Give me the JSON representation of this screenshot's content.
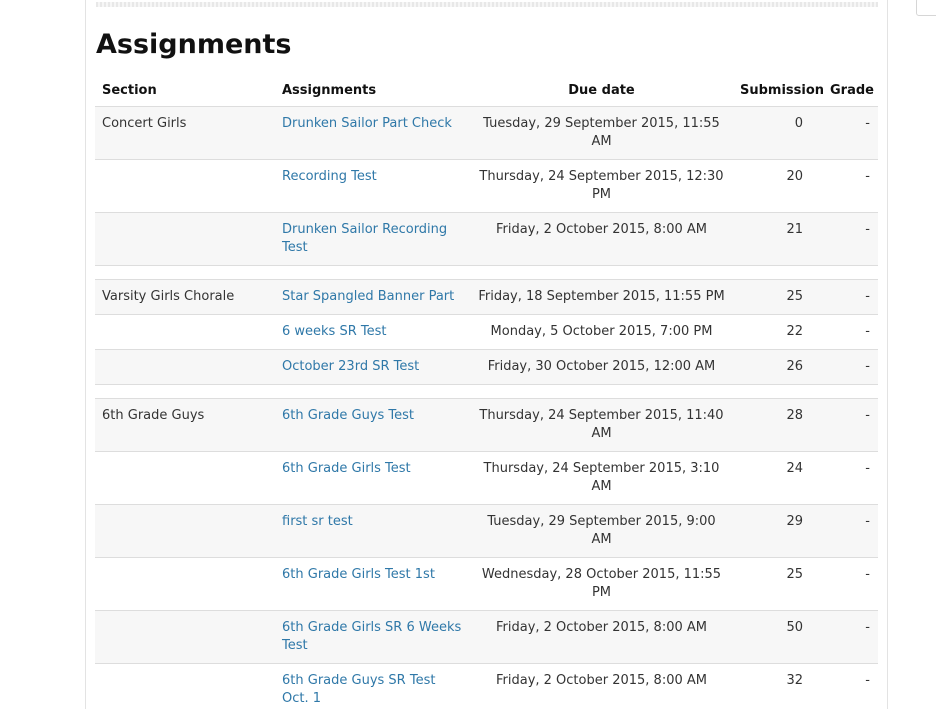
{
  "page_title": "Assignments",
  "columns": {
    "section": "Section",
    "assignments": "Assignments",
    "due": "Due date",
    "submission": "Submission",
    "grade": "Grade"
  },
  "groups": [
    {
      "section": "Concert Girls",
      "rows": [
        {
          "assignment": "Drunken Sailor Part Check",
          "due": "Tuesday, 29 September 2015, 11:55 AM",
          "submission": "0",
          "grade": "-"
        },
        {
          "assignment": "Recording Test",
          "due": "Thursday, 24 September 2015, 12:30 PM",
          "submission": "20",
          "grade": "-"
        },
        {
          "assignment": "Drunken Sailor Recording Test",
          "due": "Friday, 2 October 2015, 8:00 AM",
          "submission": "21",
          "grade": "-"
        }
      ]
    },
    {
      "section": "Varsity Girls Chorale",
      "rows": [
        {
          "assignment": "Star Spangled Banner Part",
          "due": "Friday, 18 September 2015, 11:55 PM",
          "submission": "25",
          "grade": "-"
        },
        {
          "assignment": "6 weeks SR Test",
          "due": "Monday, 5 October 2015, 7:00 PM",
          "submission": "22",
          "grade": "-"
        },
        {
          "assignment": "October 23rd SR Test",
          "due": "Friday, 30 October 2015, 12:00 AM",
          "submission": "26",
          "grade": "-"
        }
      ]
    },
    {
      "section": "6th Grade Guys",
      "rows": [
        {
          "assignment": "6th Grade Guys Test",
          "due": "Thursday, 24 September 2015, 11:40 AM",
          "submission": "28",
          "grade": "-"
        },
        {
          "assignment": "6th Grade Girls Test",
          "due": "Thursday, 24 September 2015, 3:10 AM",
          "submission": "24",
          "grade": "-"
        },
        {
          "assignment": "first sr test",
          "due": "Tuesday, 29 September 2015, 9:00 AM",
          "submission": "29",
          "grade": "-"
        },
        {
          "assignment": "6th Grade Girls Test 1st",
          "due": "Wednesday, 28 October 2015, 11:55 PM",
          "submission": "25",
          "grade": "-"
        },
        {
          "assignment": "6th Grade Girls SR 6 Weeks Test",
          "due": "Friday, 2 October 2015, 8:00 AM",
          "submission": "50",
          "grade": "-"
        },
        {
          "assignment": "6th Grade Guys SR Test Oct. 1",
          "due": "Friday, 2 October 2015, 8:00 AM",
          "submission": "32",
          "grade": "-"
        }
      ]
    }
  ]
}
